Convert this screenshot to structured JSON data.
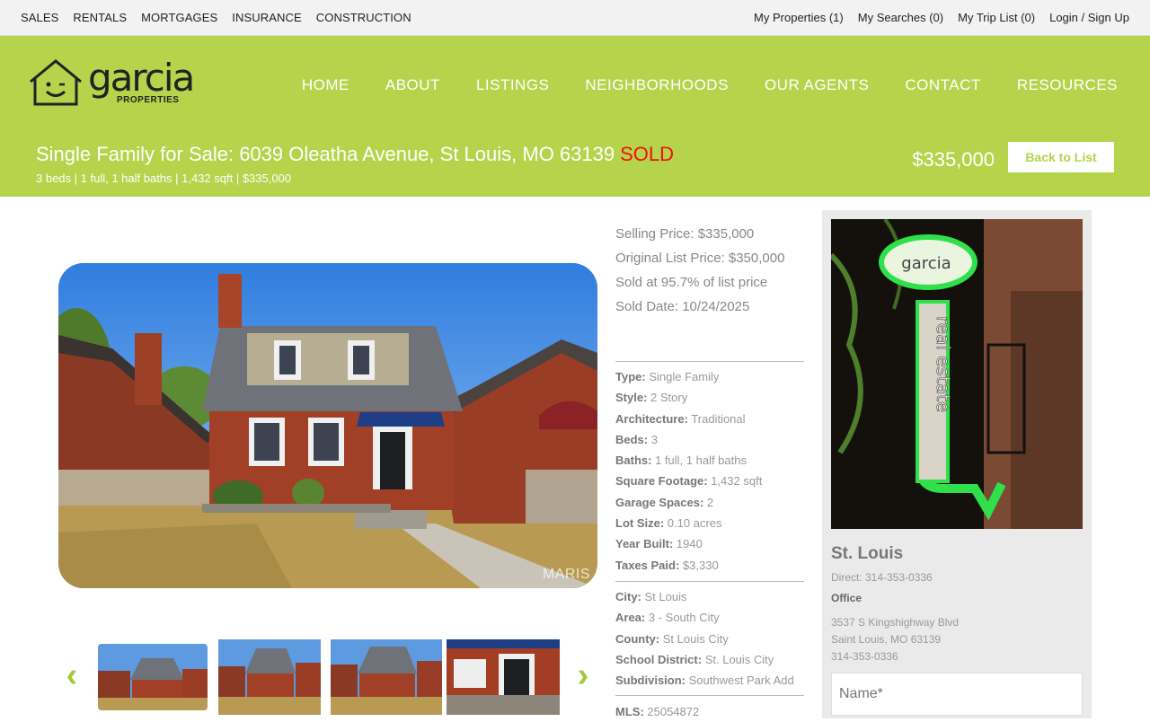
{
  "topbar": {
    "left": [
      "SALES",
      "RENTALS",
      "MORTGAGES",
      "INSURANCE",
      "CONSTRUCTION"
    ],
    "right": [
      "My Properties (1)",
      "My Searches (0)",
      "My Trip List (0)",
      "Login / Sign Up"
    ]
  },
  "logo": {
    "word": "garcia",
    "sub": "PROPERTIES"
  },
  "nav": [
    "HOME",
    "ABOUT",
    "LISTINGS",
    "NEIGHBORHOODS",
    "OUR AGENTS",
    "CONTACT",
    "RESOURCES"
  ],
  "listing": {
    "title": "Single Family for Sale: 6039 Oleatha Avenue, St Louis, MO 63139",
    "status": "SOLD",
    "meta": "3 beds | 1 full, 1 half baths | 1,432 sqft | $335,000",
    "price": "$335,000",
    "back_label": "Back to List",
    "watermark": "MARIS"
  },
  "prices": [
    "Selling Price: $335,000",
    "Original List Price: $350,000",
    "Sold at 95.7% of list price",
    "Sold Date: 10/24/2025"
  ],
  "facts1": [
    {
      "k": "Type:",
      "v": "Single Family"
    },
    {
      "k": "Style:",
      "v": "2 Story"
    },
    {
      "k": "Architecture:",
      "v": "Traditional"
    },
    {
      "k": "Beds:",
      "v": "3"
    },
    {
      "k": "Baths:",
      "v": "1 full, 1 half baths"
    },
    {
      "k": "Square Footage:",
      "v": "1,432 sqft"
    },
    {
      "k": "Garage Spaces:",
      "v": "2"
    },
    {
      "k": "Lot Size:",
      "v": "0.10 acres"
    },
    {
      "k": "Year Built:",
      "v": "1940"
    },
    {
      "k": "Taxes Paid:",
      "v": "$3,330"
    }
  ],
  "facts2": [
    {
      "k": "City:",
      "v": "St Louis"
    },
    {
      "k": "Area:",
      "v": "3 - South City"
    },
    {
      "k": "County:",
      "v": "St Louis City"
    },
    {
      "k": "School District:",
      "v": "St. Louis City"
    },
    {
      "k": "Subdivision:",
      "v": "Southwest Park Add"
    }
  ],
  "facts3": [
    {
      "k": "MLS:",
      "v": "25054872"
    }
  ],
  "agent": {
    "city": "St. Louis",
    "direct": "Direct: 314-353-0336",
    "office_label": "Office",
    "address1": "3537 S Kingshighway Blvd",
    "address2": "Saint Louis, MO 63139",
    "phone": "314-353-0336",
    "sign_text": "real estate",
    "sign_logo": "garcia",
    "name_placeholder": "Name*"
  },
  "colors": {
    "brand_green": "#b5d34b",
    "sold_red": "#e11111",
    "arrow_green": "#a6c83a"
  }
}
